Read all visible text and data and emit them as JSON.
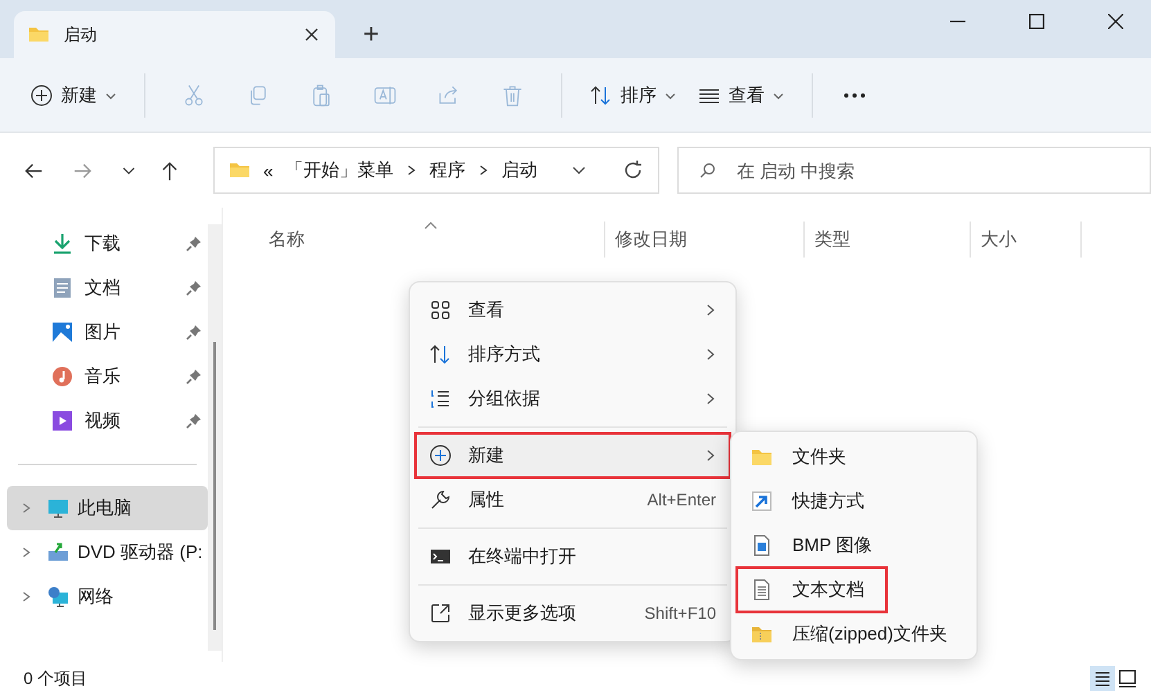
{
  "tab": {
    "title": "启动",
    "new_tab": "+"
  },
  "toolbar": {
    "new_label": "新建",
    "actions": [
      {
        "disabled": true
      },
      {
        "disabled": true
      },
      {
        "disabled": true
      },
      {
        "disabled": true
      },
      {
        "disabled": true
      },
      {
        "disabled": true
      }
    ],
    "sort_label": "排序",
    "view_label": "查看"
  },
  "address": {
    "prefix": "«",
    "path": [
      "「开始」菜单",
      "程序",
      "启动"
    ],
    "search_placeholder": "在 启动 中搜索"
  },
  "sidebar": {
    "quick": [
      {
        "label": "下载",
        "pinned": true
      },
      {
        "label": "文档",
        "pinned": true
      },
      {
        "label": "图片",
        "pinned": true
      },
      {
        "label": "音乐",
        "pinned": true
      },
      {
        "label": "视频",
        "pinned": true
      }
    ],
    "tree": [
      {
        "label": "此电脑",
        "selected": true
      },
      {
        "label": "DVD 驱动器 (P:",
        "selected": false
      },
      {
        "label": "网络",
        "selected": false
      }
    ]
  },
  "columns": [
    "名称",
    "修改日期",
    "类型",
    "大小"
  ],
  "context_menu": [
    [
      {
        "label": "查看",
        "submenu": true,
        "marked": false
      },
      {
        "label": "排序方式",
        "submenu": true,
        "marked": false
      },
      {
        "label": "分组依据",
        "submenu": true,
        "marked": false
      }
    ],
    [
      {
        "label": "新建",
        "submenu": true,
        "marked": true
      },
      {
        "label": "属性",
        "shortcut": "Alt+Enter",
        "submenu": false,
        "marked": false
      }
    ],
    [
      {
        "label": "在终端中打开",
        "submenu": false,
        "marked": false
      }
    ],
    [
      {
        "label": "显示更多选项",
        "shortcut": "Shift+F10",
        "submenu": false,
        "marked": false
      }
    ]
  ],
  "new_submenu": [
    {
      "label": "文件夹",
      "marked": false
    },
    {
      "label": "快捷方式",
      "marked": false
    },
    {
      "label": "BMP 图像",
      "marked": false
    },
    {
      "label": "文本文档",
      "marked": true
    },
    {
      "label": "压缩(zipped)文件夹",
      "marked": false
    }
  ],
  "status_bar": "0 个项目"
}
